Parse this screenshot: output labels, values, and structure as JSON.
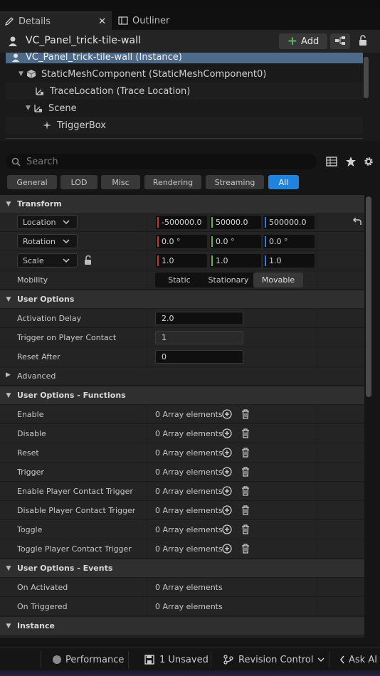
{
  "tabs": {
    "details": "Details",
    "outliner": "Outliner"
  },
  "header": {
    "title": "VC_Panel_trick-tile-wall",
    "add_label": "Add"
  },
  "tree": [
    {
      "label": "VC_Panel_trick-tile-wall (Instance)",
      "icon": "actor-icon"
    },
    {
      "label": "StaticMeshComponent (StaticMeshComponent0)",
      "icon": "cube-icon"
    },
    {
      "label": "TraceLocation (Trace Location)",
      "icon": "scene-component-icon"
    },
    {
      "label": "Scene",
      "icon": "scene-component-icon"
    },
    {
      "label": "TriggerBox",
      "icon": "trigger-box-icon"
    }
  ],
  "search": {
    "placeholder": "Search"
  },
  "filters": [
    "General",
    "LOD",
    "Misc",
    "Rendering",
    "Streaming",
    "All"
  ],
  "transform": {
    "category": "Transform",
    "location": {
      "label": "Location",
      "x": "-500000.0",
      "y": "50000.0",
      "z": "500000.0"
    },
    "rotation": {
      "label": "Rotation",
      "x": "0.0 °",
      "y": "0.0 °",
      "z": "0.0 °"
    },
    "scale": {
      "label": "Scale",
      "x": "1.0",
      "y": "1.0",
      "z": "1.0"
    },
    "mobility": {
      "label": "Mobility",
      "options": [
        "Static",
        "Stationary",
        "Movable"
      ],
      "selected": "Movable"
    }
  },
  "user_options": {
    "category": "User Options",
    "activation_delay": {
      "label": "Activation Delay",
      "value": "2.0"
    },
    "trigger_on_contact": {
      "label": "Trigger on Player Contact",
      "value": "1"
    },
    "reset_after": {
      "label": "Reset After",
      "value": "0"
    },
    "advanced": "Advanced"
  },
  "functions": {
    "category": "User Options - Functions",
    "rows": [
      {
        "label": "Enable",
        "value": "0 Array elements"
      },
      {
        "label": "Disable",
        "value": "0 Array elements"
      },
      {
        "label": "Reset",
        "value": "0 Array elements"
      },
      {
        "label": "Trigger",
        "value": "0 Array elements"
      },
      {
        "label": "Enable Player Contact Trigger",
        "value": "0 Array elements"
      },
      {
        "label": "Disable Player Contact Trigger",
        "value": "0 Array elements"
      },
      {
        "label": "Toggle",
        "value": "0 Array elements"
      },
      {
        "label": "Toggle Player Contact Trigger",
        "value": "0 Array elements"
      }
    ]
  },
  "events": {
    "category": "User Options - Events",
    "rows": [
      {
        "label": "On Activated",
        "value": "0 Array elements"
      },
      {
        "label": "On Triggered",
        "value": "0 Array elements"
      }
    ]
  },
  "instance": {
    "category": "Instance"
  },
  "statusbar": {
    "performance": "Performance",
    "unsaved": "1 Unsaved",
    "revision": "Revision Control",
    "ask_ai": "Ask AI"
  },
  "colors": {
    "accent": "#1f84e0",
    "x_axis": "#c0392b",
    "y_axis": "#6ab04c",
    "z_axis": "#2f7be6",
    "add_plus": "#5cb85c"
  }
}
